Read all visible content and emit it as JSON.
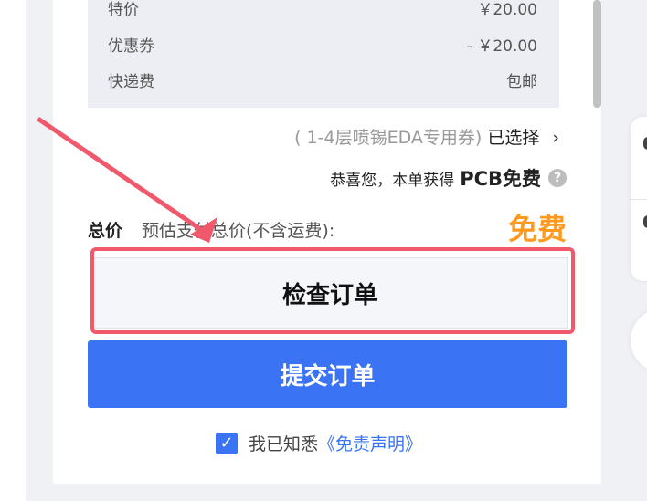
{
  "fees": [
    {
      "label": "特价",
      "value": "￥20.00"
    },
    {
      "label": "优惠券",
      "value": "- ￥20.00"
    },
    {
      "label": "快递费",
      "value": "包邮"
    }
  ],
  "coupon": {
    "text": "( 1-4层喷锡EDA专用券)",
    "selected": "已选择",
    "chevron": "chevron-right-icon"
  },
  "congrats": {
    "text": "恭喜您，本单获得",
    "highlight": "PCB免费",
    "help": "?"
  },
  "total": {
    "label": "总价",
    "desc": "预估支付总价(不含运费):",
    "value": "免费"
  },
  "buttons": {
    "check": "检查订单",
    "submit": "提交订单"
  },
  "agreement": {
    "text": "我已知悉",
    "link": "《免责声明》",
    "checked": true
  },
  "colors": {
    "accent": "#3a74f5",
    "highlight": "#f0586c",
    "free": "#ff9a1f"
  }
}
